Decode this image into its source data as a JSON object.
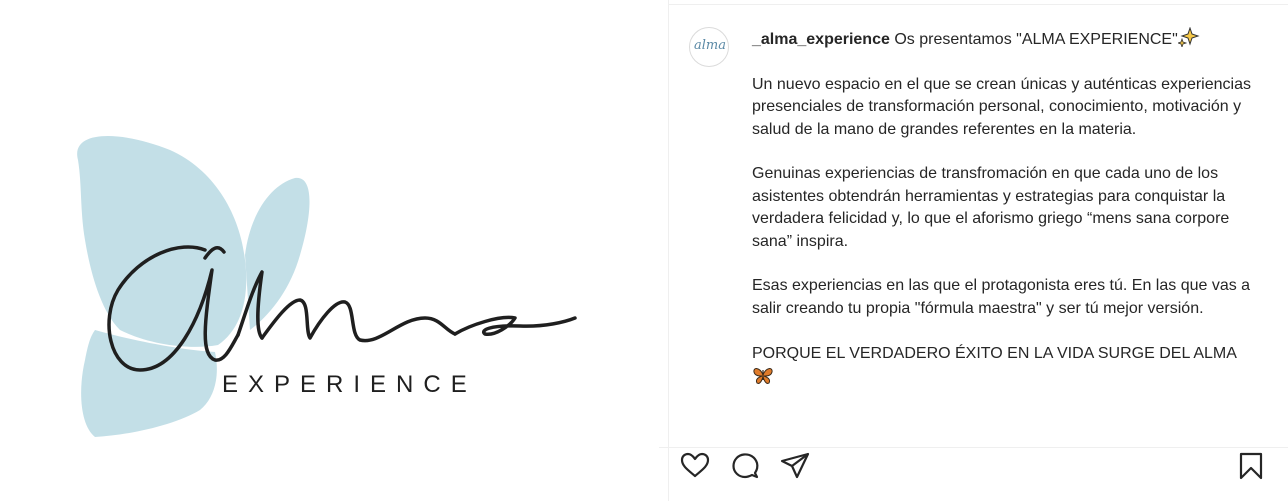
{
  "media": {
    "logo_word": "EXPERIENCE",
    "logo_script": "alma",
    "colors": {
      "blob": "#c3dfe7",
      "ink": "#1f1f1f"
    }
  },
  "post": {
    "username": "_alma_experience",
    "caption_intro": " Os presentamos \"ALMA EXPERIENCE\"",
    "intro_emoji": "sparkles-icon",
    "paragraphs": [
      "Un nuevo espacio en el que se crean únicas y auténticas experiencias presenciales de transformación personal, conocimiento, motivación y salud de la mano de grandes referentes en la materia.",
      "Genuinas experiencias de transfromación en que cada uno de los asistentes obtendrán herramientas y estrategias para conquistar la verdadera felicidad y, lo que el aforismo griego “mens sana corpore sana” inspira.",
      "Esas experiencias en las que el protagonista eres tú. En las que vas a salir creando tu propia \"fórmula maestra\" y ser tú mejor versión.",
      "PORQUE EL VERDADERO ÉXITO EN LA VIDA SURGE DEL ALMA"
    ],
    "closing_emoji": "butterfly-icon"
  },
  "actions": [
    "like-icon",
    "comment-icon",
    "share-icon",
    "save-icon"
  ]
}
